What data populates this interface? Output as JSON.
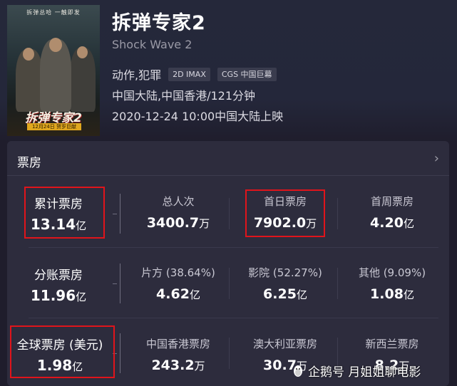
{
  "movie": {
    "title": "拆弹专家2",
    "subtitle": "Shock Wave 2",
    "genre": "动作,犯罪",
    "tags": [
      "2D IMAX",
      "CGS 中国巨幕"
    ],
    "region_duration": "中国大陆,中国香港/121分钟",
    "release": "2020-12-24 10:00中国大陆上映",
    "poster": {
      "tagline": "拆弹总哈 一触即发",
      "title": "拆弹专家2",
      "date": "12月24日 贺岁巨献"
    }
  },
  "box_office": {
    "title": "票房",
    "arrow": "›",
    "rows": [
      {
        "main": {
          "label": "累计票房",
          "value": "13.14",
          "unit": "亿"
        },
        "items": [
          {
            "label": "总人次",
            "value": "3400.7",
            "unit": "万"
          },
          {
            "label": "首日票房",
            "value": "7902.0",
            "unit": "万"
          },
          {
            "label": "首周票房",
            "value": "4.20",
            "unit": "亿"
          }
        ]
      },
      {
        "main": {
          "label": "分账票房",
          "value": "11.96",
          "unit": "亿"
        },
        "items": [
          {
            "label": "片方 (38.64%)",
            "value": "4.62",
            "unit": "亿"
          },
          {
            "label": "影院 (52.27%)",
            "value": "6.25",
            "unit": "亿"
          },
          {
            "label": "其他 (9.09%)",
            "value": "1.08",
            "unit": "亿"
          }
        ]
      },
      {
        "main": {
          "label": "全球票房 (美元)",
          "value": "1.98",
          "unit": "亿"
        },
        "items": [
          {
            "label": "中国香港票房",
            "value": "243.2",
            "unit": "万"
          },
          {
            "label": "澳大利亚票房",
            "value": "30.7",
            "unit": "万"
          },
          {
            "label": "新西兰票房",
            "value": "8.2",
            "unit": "万"
          }
        ]
      }
    ]
  },
  "watermark": "企鹅号 月姐姐聊电影",
  "colors": {
    "highlight": "#e0141b",
    "background": "#1f1d2c",
    "card": "#2d2c3d"
  }
}
